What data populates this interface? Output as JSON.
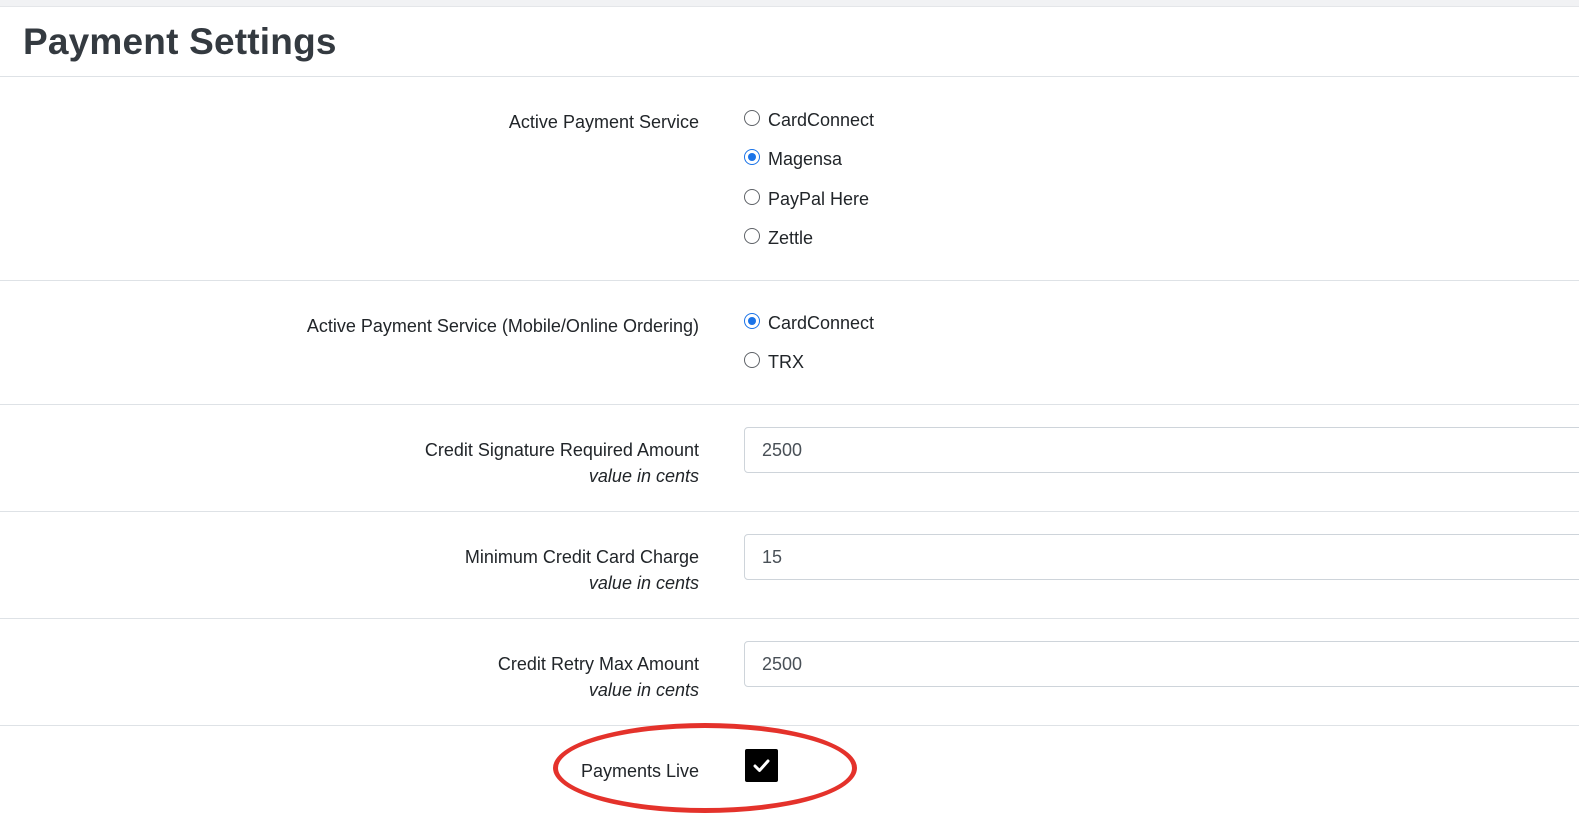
{
  "page": {
    "title": "Payment Settings"
  },
  "active_payment_service": {
    "label": "Active Payment Service",
    "options": [
      {
        "label": "CardConnect",
        "checked": false
      },
      {
        "label": "Magensa",
        "checked": true
      },
      {
        "label": "PayPal Here",
        "checked": false
      },
      {
        "label": "Zettle",
        "checked": false
      }
    ]
  },
  "active_payment_service_mobile": {
    "label": "Active Payment Service (Mobile/Online Ordering)",
    "options": [
      {
        "label": "CardConnect",
        "checked": true
      },
      {
        "label": "TRX",
        "checked": false
      }
    ]
  },
  "credit_signature_required_amount": {
    "label": "Credit Signature Required Amount",
    "hint": "value in cents",
    "value": "2500"
  },
  "minimum_credit_card_charge": {
    "label": "Minimum Credit Card Charge",
    "hint": "value in cents",
    "value": "15"
  },
  "credit_retry_max_amount": {
    "label": "Credit Retry Max Amount",
    "hint": "value in cents",
    "value": "2500"
  },
  "payments_live": {
    "label": "Payments Live",
    "checked": true,
    "highlight_color": "#e4322b"
  },
  "colors": {
    "accent": "#1a73e8",
    "title": "#343a40",
    "divider": "#dee2e6"
  }
}
